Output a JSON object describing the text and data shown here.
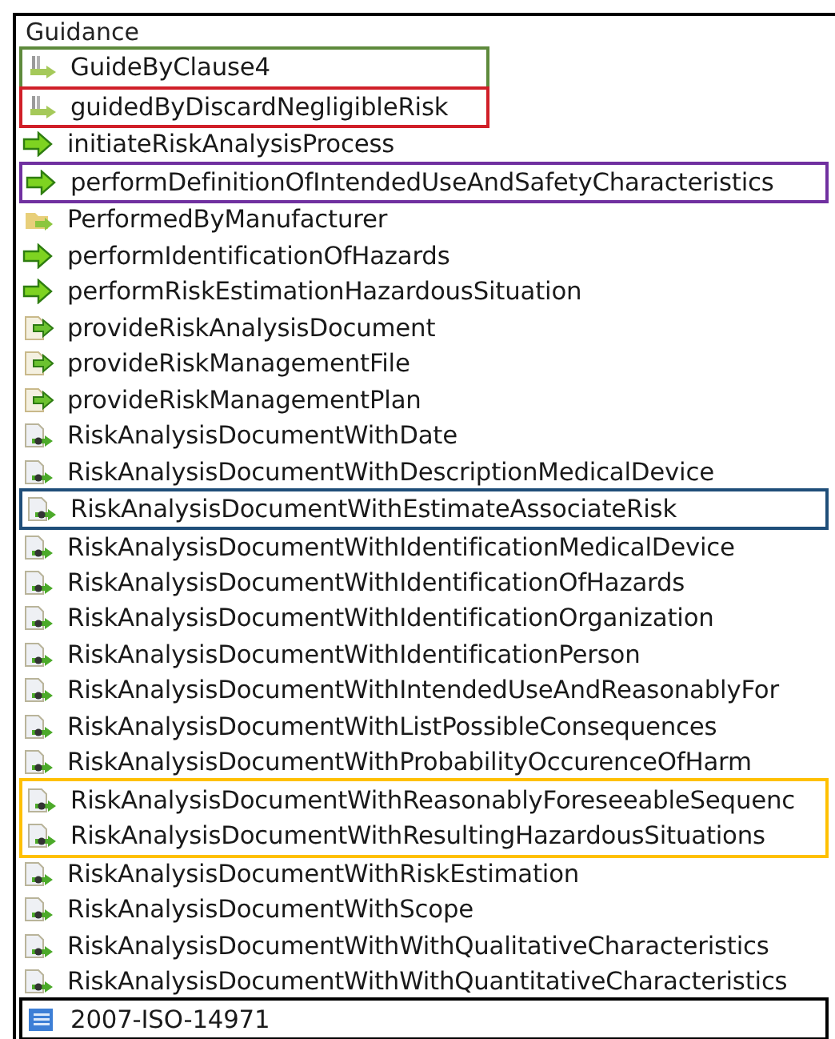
{
  "panel": {
    "title": "Guidance"
  },
  "items": [
    {
      "kind": "stub",
      "label": "GuideByClause4",
      "color": "#5e8a3c"
    },
    {
      "kind": "stub",
      "label": "guidedByDiscardNegligibleRisk",
      "color": "#d01f28"
    },
    {
      "kind": "action",
      "label": "initiateRiskAnalysisProcess"
    },
    {
      "kind": "action",
      "label": "performDefinitionOfIntendedUseAndSafetyCharacteristics",
      "color": "#7030a0"
    },
    {
      "kind": "folder",
      "label": "PerformedByManufacturer"
    },
    {
      "kind": "action",
      "label": "performIdentificationOfHazards"
    },
    {
      "kind": "action",
      "label": "performRiskEstimationHazardousSituation"
    },
    {
      "kind": "provide",
      "label": "provideRiskAnalysisDocument"
    },
    {
      "kind": "provide",
      "label": "provideRiskManagementFile"
    },
    {
      "kind": "provide",
      "label": "provideRiskManagementPlan"
    },
    {
      "kind": "document",
      "label": "RiskAnalysisDocumentWithDate"
    },
    {
      "kind": "document",
      "label": "RiskAnalysisDocumentWithDescriptionMedicalDevice"
    },
    {
      "kind": "document",
      "label": "RiskAnalysisDocumentWithEstimateAssociateRisk",
      "color": "#1f4e79"
    },
    {
      "kind": "document",
      "label": "RiskAnalysisDocumentWithIdentificationMedicalDevice"
    },
    {
      "kind": "document",
      "label": "RiskAnalysisDocumentWithIdentificationOfHazards"
    },
    {
      "kind": "document",
      "label": "RiskAnalysisDocumentWithIdentificationOrganization"
    },
    {
      "kind": "document",
      "label": "RiskAnalysisDocumentWithIdentificationPerson"
    },
    {
      "kind": "document",
      "label": "RiskAnalysisDocumentWithIntendedUseAndReasonablyFor"
    },
    {
      "kind": "document",
      "label": "RiskAnalysisDocumentWithListPossibleConsequences"
    },
    {
      "kind": "document",
      "label": "RiskAnalysisDocumentWithProbabilityOccurenceOfHarm"
    },
    {
      "kind": "document",
      "label": "RiskAnalysisDocumentWithReasonablyForeseeableSequenc",
      "color": "#ffc000"
    },
    {
      "kind": "document",
      "label": "RiskAnalysisDocumentWithResultingHazardousSituations",
      "color": "#ffc000"
    },
    {
      "kind": "document",
      "label": "RiskAnalysisDocumentWithRiskEstimation"
    },
    {
      "kind": "document",
      "label": "RiskAnalysisDocumentWithScope"
    },
    {
      "kind": "document",
      "label": "RiskAnalysisDocumentWithWithQualitativeCharacteristics"
    },
    {
      "kind": "document",
      "label": "RiskAnalysisDocumentWithWithQuantitativeCharacteristics"
    },
    {
      "kind": "list",
      "label": "2007-ISO-14971",
      "color": "#000000"
    }
  ]
}
